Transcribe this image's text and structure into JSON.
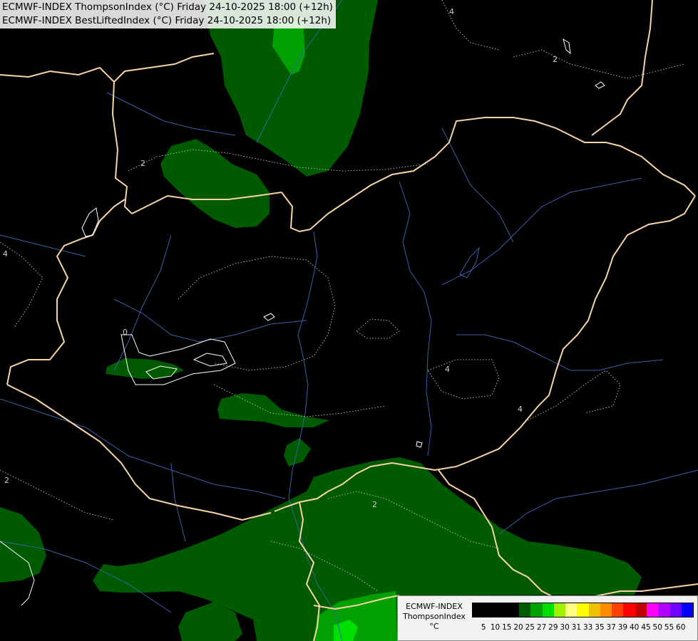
{
  "title": {
    "line1": "ECMWF-INDEX ThompsonIndex (°C) Friday 24-10-2025 18:00 (+12h)",
    "line2": "ECMWF-INDEX BestLiftedIndex (°C) Friday 24-10-2025 18:00 (+12h)"
  },
  "contour_labels": [
    "4",
    "2",
    "2",
    "4",
    "0",
    "4",
    "4",
    "2",
    "2"
  ],
  "legend": {
    "title_line1": "ECMWF-INDEX",
    "title_line2": "ThompsonIndex",
    "unit": "°C",
    "ticks": [
      "5",
      "10",
      "15",
      "20",
      "25",
      "27",
      "29",
      "30",
      "31",
      "33",
      "35",
      "37",
      "39",
      "40",
      "45",
      "50",
      "55",
      "60"
    ],
    "colors": [
      "#000000",
      "#000000",
      "#000000",
      "#000000",
      "#005a00",
      "#00a000",
      "#00e000",
      "#a0f000",
      "#ffff80",
      "#ffff00",
      "#f0c000",
      "#ff8c00",
      "#ff4000",
      "#ff0000",
      "#c00000",
      "#ff00ff",
      "#b000ff",
      "#7000ff",
      "#0000ff"
    ]
  },
  "colors": {
    "background": "#000000",
    "border": "#f7d4a6",
    "river": "#3a5fa8",
    "contour": "#b8b8b8",
    "green_dark": "#005a00",
    "green_mid": "#00a000",
    "green_bright": "#00e000"
  }
}
